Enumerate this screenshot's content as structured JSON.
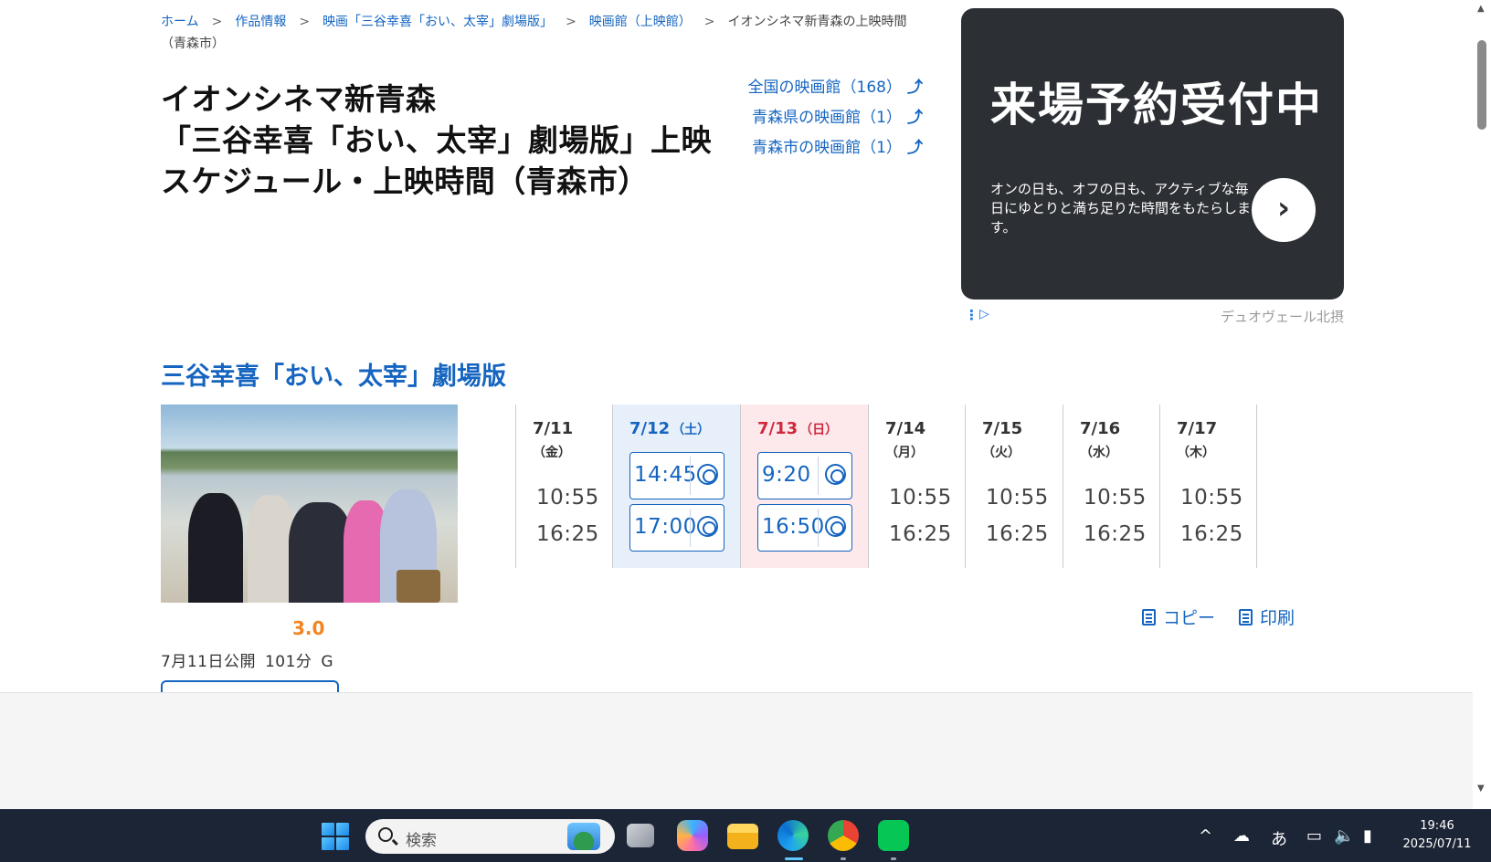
{
  "breadcrumb": {
    "items": [
      "ホーム",
      "作品情報",
      "映画「三谷幸喜「おい、太宰」劇場版」",
      "映画館（上映館）"
    ],
    "current": "イオンシネマ新青森の上映時間（青森市）",
    "separator": ">"
  },
  "page_title": {
    "line1": "イオンシネマ新青森",
    "line2": "「三谷幸喜「おい、太宰」劇場版」上映スケジュール・上映時間（青森市）"
  },
  "region_links": [
    "全国の映画館（168）",
    "青森県の映画館（1）",
    "青森市の映画館（1）"
  ],
  "ad": {
    "headline": "来場予約受付中",
    "body": "オンの日も、オフの日も、アクティブな毎日にゆとりと満ち足りた時間をもたらします。",
    "advertiser": "デュオヴェール北摂",
    "cta_icon": "chevron-right-icon"
  },
  "movie": {
    "title": "三谷幸喜「おい、太宰」劇場版",
    "rating": "3.0",
    "release": "7月11日公開",
    "runtime": "101分",
    "classification": "G"
  },
  "schedule": {
    "days": [
      {
        "date": "7/11",
        "dow": "（金）",
        "type": "weekday",
        "times": [
          "10:55",
          "16:25"
        ]
      },
      {
        "date": "7/12",
        "dow": "（土）",
        "type": "sat",
        "times": [
          "14:45",
          "17:00"
        ]
      },
      {
        "date": "7/13",
        "dow": "（日）",
        "type": "sun",
        "times": [
          "9:20",
          "16:50"
        ]
      },
      {
        "date": "7/14",
        "dow": "（月）",
        "type": "weekday",
        "times": [
          "10:55",
          "16:25"
        ]
      },
      {
        "date": "7/15",
        "dow": "（火）",
        "type": "weekday",
        "times": [
          "10:55",
          "16:25"
        ]
      },
      {
        "date": "7/16",
        "dow": "（水）",
        "type": "weekday",
        "times": [
          "10:55",
          "16:25"
        ]
      },
      {
        "date": "7/17",
        "dow": "（木）",
        "type": "weekday",
        "times": [
          "10:55",
          "16:25"
        ]
      }
    ]
  },
  "actions": {
    "copy": "コピー",
    "print": "印刷"
  },
  "taskbar": {
    "search_placeholder": "検索",
    "ime": "あ",
    "time": "19:46",
    "date": "2025/07/11"
  },
  "colors": {
    "link": "#1565c0",
    "sat_bg": "#e7effb",
    "sun_bg": "#fde9ec",
    "rating": "#f5841f",
    "taskbar": "#1c2536"
  }
}
